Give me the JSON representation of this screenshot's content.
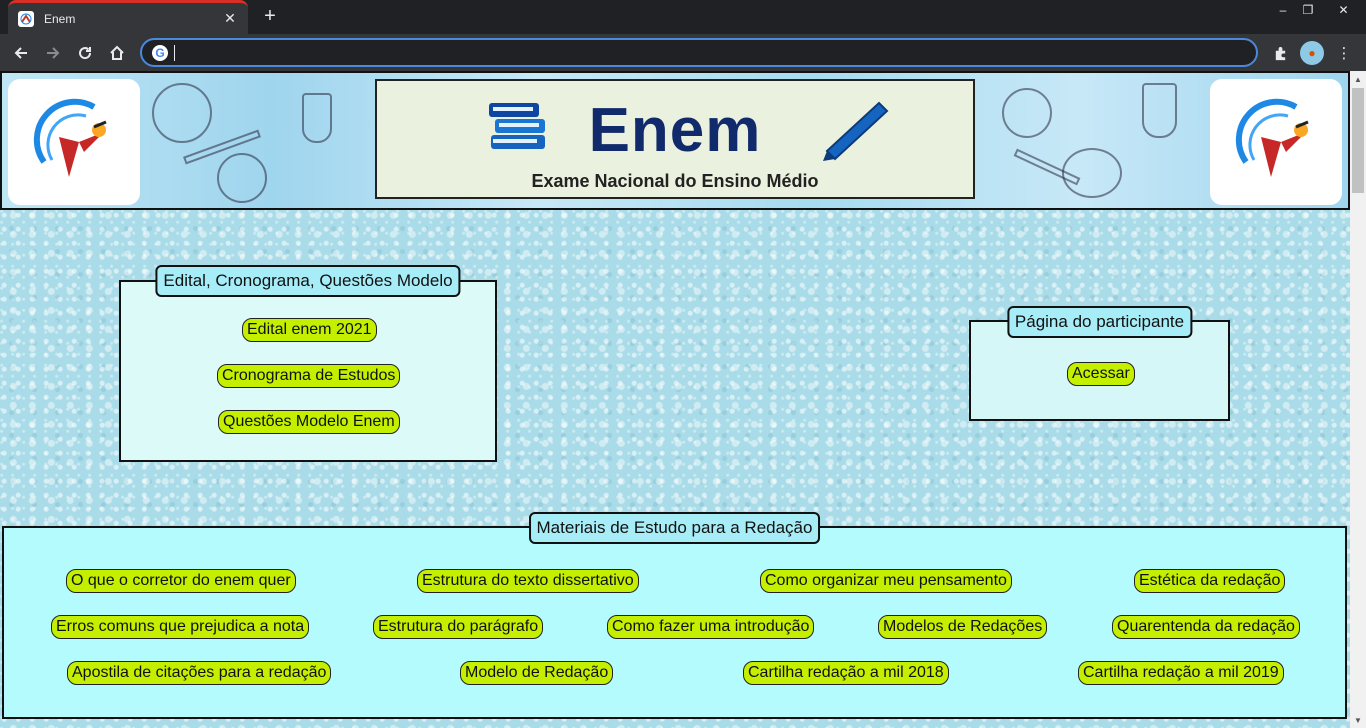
{
  "browser": {
    "tab_title": "Enem",
    "address_value": "",
    "window_controls": {
      "minimize": "‒",
      "maximize": "❐",
      "close": "✕"
    }
  },
  "banner": {
    "title": "Enem",
    "subtitle": "Exame Nacional do Ensino Médio"
  },
  "edital": {
    "legend": "Edital, Cronograma, Questões Modelo",
    "links": [
      "Edital enem 2021",
      "Cronograma de Estudos",
      "Questões Modelo Enem"
    ]
  },
  "participante": {
    "legend": "Página do participante",
    "link": "Acessar"
  },
  "materiais": {
    "legend": "Materiais de Estudo para a Redação",
    "links": [
      "O que o corretor do enem quer",
      "Estrutura do texto dissertativo",
      "Como organizar meu pensamento",
      "Estética da redação",
      "Erros comuns que prejudica a nota",
      "Estrutura do parágrafo",
      "Como fazer uma introdução",
      "Modelos de Redações",
      "Quarentenda da redação",
      "Apostila de citações para a redação",
      "Modelo de Redação",
      "Cartilha redação a mil 2018",
      "Cartilha redação a mil 2019"
    ]
  },
  "colors": {
    "pill": "#c4f000",
    "legend_bg": "#a6edf8",
    "page_bg": "#a9dce8",
    "title_blue": "#102a6b"
  }
}
